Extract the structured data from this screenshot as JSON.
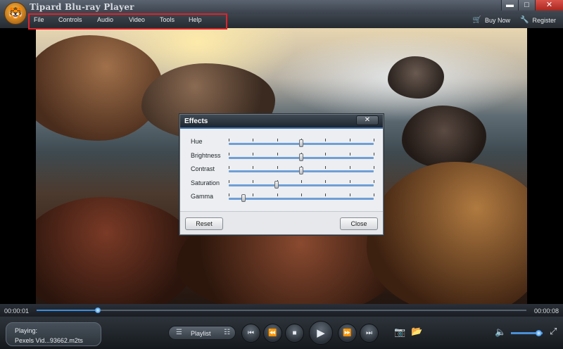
{
  "app": {
    "title": "Tipard Blu-ray Player"
  },
  "window_controls": {
    "minimize": "▬",
    "maximize": "□",
    "close": "✕"
  },
  "menu": {
    "items": [
      "File",
      "Controls",
      "Audio",
      "Video",
      "Tools",
      "Help"
    ],
    "buy_now": "Buy Now",
    "register": "Register"
  },
  "effects_dialog": {
    "title": "Effects",
    "close_icon": "✕",
    "sliders": [
      {
        "label": "Hue",
        "value": 0.5
      },
      {
        "label": "Brightness",
        "value": 0.5
      },
      {
        "label": "Contrast",
        "value": 0.5
      },
      {
        "label": "Saturation",
        "value": 0.33
      },
      {
        "label": "Gamma",
        "value": 0.1
      }
    ],
    "reset_label": "Reset",
    "close_label": "Close"
  },
  "playback": {
    "current_time": "00:00:01",
    "total_time": "00:00:08",
    "progress": 0.125,
    "status_label": "Playing:",
    "file_name": "Pexels Vid...93662.m2ts",
    "playlist_label": "Playlist",
    "volume": 0.87
  },
  "icons": {
    "menu_icon": "☰",
    "playlist_icon": "☷",
    "prev_chapter": "⏮",
    "rewind": "⏪",
    "stop": "■",
    "play": "▶",
    "forward": "⏩",
    "next_chapter": "⏭",
    "snapshot": "📷",
    "open_folder": "📂",
    "volume": "🔈",
    "fullscreen": "⤢",
    "buy_now": "🛒",
    "register": "🔧"
  }
}
